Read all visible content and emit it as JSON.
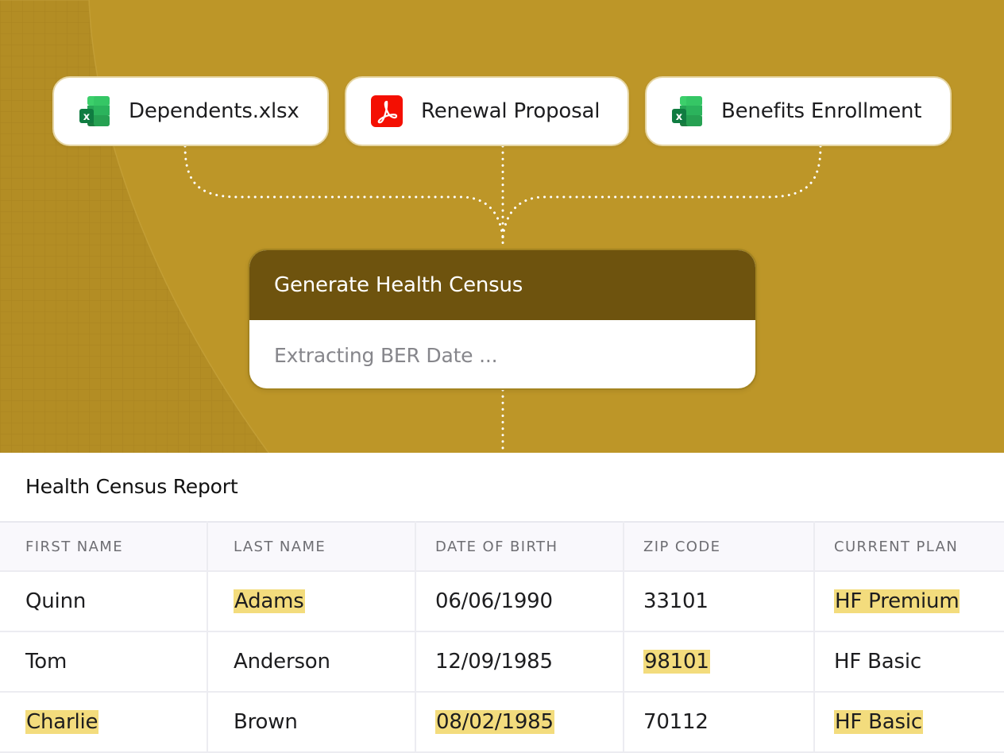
{
  "source_files": [
    {
      "label": "Dependents.xlsx",
      "icon": "excel-icon"
    },
    {
      "label": "Renewal Proposal",
      "icon": "pdf-icon"
    },
    {
      "label": "Benefits Enrollment",
      "icon": "excel-icon"
    }
  ],
  "process": {
    "title": "Generate Health Census",
    "status": "Extracting BER Date ..."
  },
  "report": {
    "title": "Health Census Report",
    "columns": [
      "FIRST NAME",
      "LAST NAME",
      "DATE OF BIRTH",
      "ZIP CODE",
      "CURRENT PLAN"
    ],
    "rows": [
      {
        "first_name": "Quinn",
        "last_name": "Adams",
        "dob": "06/06/1990",
        "zip": "33101",
        "plan": "HF Premium",
        "highlighted": [
          "last_name",
          "plan"
        ]
      },
      {
        "first_name": "Tom",
        "last_name": "Anderson",
        "dob": "12/09/1985",
        "zip": "98101",
        "plan": "HF Basic",
        "highlighted": [
          "zip"
        ]
      },
      {
        "first_name": "Charlie",
        "last_name": "Brown",
        "dob": "08/02/1985",
        "zip": "70112",
        "plan": "HF Basic",
        "highlighted": [
          "first_name",
          "dob",
          "plan"
        ]
      }
    ]
  },
  "colors": {
    "background": "#bd9628",
    "card_header": "#6e530e",
    "highlight": "#f3dc7d",
    "excel_green": "#1f7a3f",
    "pdf_red": "#f40f02"
  }
}
